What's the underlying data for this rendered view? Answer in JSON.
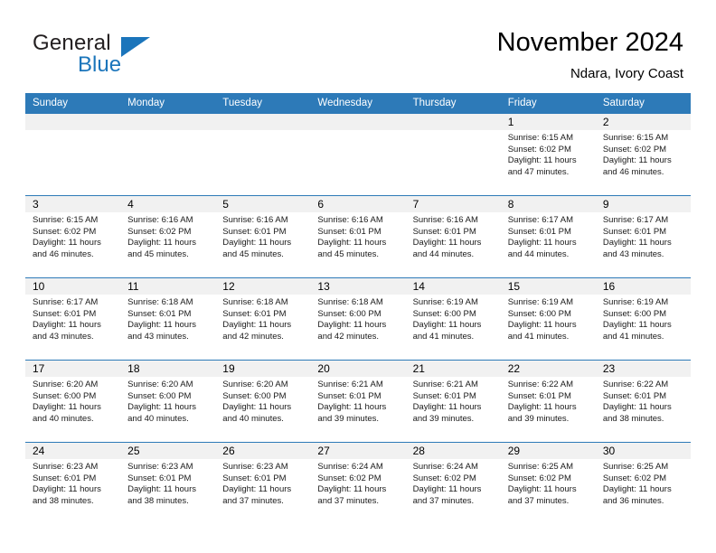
{
  "logo": {
    "primary_text": "General",
    "secondary_text": "Blue",
    "icon": "triangle-mark",
    "primary_color": "#231f20",
    "accent_color": "#1b75bb"
  },
  "header": {
    "title": "November 2024",
    "subtitle": "Ndara, Ivory Coast"
  },
  "theme": {
    "header_blue": "#2d7ab8",
    "day_band_gray": "#f1f1f1",
    "text_color": "#1a1a1a"
  },
  "calendar": {
    "weekdays": [
      "Sunday",
      "Monday",
      "Tuesday",
      "Wednesday",
      "Thursday",
      "Friday",
      "Saturday"
    ],
    "weeks": [
      [
        {
          "day": "",
          "sunrise": "",
          "sunset": "",
          "daylight_line1": "",
          "daylight_line2": ""
        },
        {
          "day": "",
          "sunrise": "",
          "sunset": "",
          "daylight_line1": "",
          "daylight_line2": ""
        },
        {
          "day": "",
          "sunrise": "",
          "sunset": "",
          "daylight_line1": "",
          "daylight_line2": ""
        },
        {
          "day": "",
          "sunrise": "",
          "sunset": "",
          "daylight_line1": "",
          "daylight_line2": ""
        },
        {
          "day": "",
          "sunrise": "",
          "sunset": "",
          "daylight_line1": "",
          "daylight_line2": ""
        },
        {
          "day": "1",
          "sunrise": "Sunrise: 6:15 AM",
          "sunset": "Sunset: 6:02 PM",
          "daylight_line1": "Daylight: 11 hours",
          "daylight_line2": "and 47 minutes."
        },
        {
          "day": "2",
          "sunrise": "Sunrise: 6:15 AM",
          "sunset": "Sunset: 6:02 PM",
          "daylight_line1": "Daylight: 11 hours",
          "daylight_line2": "and 46 minutes."
        }
      ],
      [
        {
          "day": "3",
          "sunrise": "Sunrise: 6:15 AM",
          "sunset": "Sunset: 6:02 PM",
          "daylight_line1": "Daylight: 11 hours",
          "daylight_line2": "and 46 minutes."
        },
        {
          "day": "4",
          "sunrise": "Sunrise: 6:16 AM",
          "sunset": "Sunset: 6:02 PM",
          "daylight_line1": "Daylight: 11 hours",
          "daylight_line2": "and 45 minutes."
        },
        {
          "day": "5",
          "sunrise": "Sunrise: 6:16 AM",
          "sunset": "Sunset: 6:01 PM",
          "daylight_line1": "Daylight: 11 hours",
          "daylight_line2": "and 45 minutes."
        },
        {
          "day": "6",
          "sunrise": "Sunrise: 6:16 AM",
          "sunset": "Sunset: 6:01 PM",
          "daylight_line1": "Daylight: 11 hours",
          "daylight_line2": "and 45 minutes."
        },
        {
          "day": "7",
          "sunrise": "Sunrise: 6:16 AM",
          "sunset": "Sunset: 6:01 PM",
          "daylight_line1": "Daylight: 11 hours",
          "daylight_line2": "and 44 minutes."
        },
        {
          "day": "8",
          "sunrise": "Sunrise: 6:17 AM",
          "sunset": "Sunset: 6:01 PM",
          "daylight_line1": "Daylight: 11 hours",
          "daylight_line2": "and 44 minutes."
        },
        {
          "day": "9",
          "sunrise": "Sunrise: 6:17 AM",
          "sunset": "Sunset: 6:01 PM",
          "daylight_line1": "Daylight: 11 hours",
          "daylight_line2": "and 43 minutes."
        }
      ],
      [
        {
          "day": "10",
          "sunrise": "Sunrise: 6:17 AM",
          "sunset": "Sunset: 6:01 PM",
          "daylight_line1": "Daylight: 11 hours",
          "daylight_line2": "and 43 minutes."
        },
        {
          "day": "11",
          "sunrise": "Sunrise: 6:18 AM",
          "sunset": "Sunset: 6:01 PM",
          "daylight_line1": "Daylight: 11 hours",
          "daylight_line2": "and 43 minutes."
        },
        {
          "day": "12",
          "sunrise": "Sunrise: 6:18 AM",
          "sunset": "Sunset: 6:01 PM",
          "daylight_line1": "Daylight: 11 hours",
          "daylight_line2": "and 42 minutes."
        },
        {
          "day": "13",
          "sunrise": "Sunrise: 6:18 AM",
          "sunset": "Sunset: 6:00 PM",
          "daylight_line1": "Daylight: 11 hours",
          "daylight_line2": "and 42 minutes."
        },
        {
          "day": "14",
          "sunrise": "Sunrise: 6:19 AM",
          "sunset": "Sunset: 6:00 PM",
          "daylight_line1": "Daylight: 11 hours",
          "daylight_line2": "and 41 minutes."
        },
        {
          "day": "15",
          "sunrise": "Sunrise: 6:19 AM",
          "sunset": "Sunset: 6:00 PM",
          "daylight_line1": "Daylight: 11 hours",
          "daylight_line2": "and 41 minutes."
        },
        {
          "day": "16",
          "sunrise": "Sunrise: 6:19 AM",
          "sunset": "Sunset: 6:00 PM",
          "daylight_line1": "Daylight: 11 hours",
          "daylight_line2": "and 41 minutes."
        }
      ],
      [
        {
          "day": "17",
          "sunrise": "Sunrise: 6:20 AM",
          "sunset": "Sunset: 6:00 PM",
          "daylight_line1": "Daylight: 11 hours",
          "daylight_line2": "and 40 minutes."
        },
        {
          "day": "18",
          "sunrise": "Sunrise: 6:20 AM",
          "sunset": "Sunset: 6:00 PM",
          "daylight_line1": "Daylight: 11 hours",
          "daylight_line2": "and 40 minutes."
        },
        {
          "day": "19",
          "sunrise": "Sunrise: 6:20 AM",
          "sunset": "Sunset: 6:00 PM",
          "daylight_line1": "Daylight: 11 hours",
          "daylight_line2": "and 40 minutes."
        },
        {
          "day": "20",
          "sunrise": "Sunrise: 6:21 AM",
          "sunset": "Sunset: 6:01 PM",
          "daylight_line1": "Daylight: 11 hours",
          "daylight_line2": "and 39 minutes."
        },
        {
          "day": "21",
          "sunrise": "Sunrise: 6:21 AM",
          "sunset": "Sunset: 6:01 PM",
          "daylight_line1": "Daylight: 11 hours",
          "daylight_line2": "and 39 minutes."
        },
        {
          "day": "22",
          "sunrise": "Sunrise: 6:22 AM",
          "sunset": "Sunset: 6:01 PM",
          "daylight_line1": "Daylight: 11 hours",
          "daylight_line2": "and 39 minutes."
        },
        {
          "day": "23",
          "sunrise": "Sunrise: 6:22 AM",
          "sunset": "Sunset: 6:01 PM",
          "daylight_line1": "Daylight: 11 hours",
          "daylight_line2": "and 38 minutes."
        }
      ],
      [
        {
          "day": "24",
          "sunrise": "Sunrise: 6:23 AM",
          "sunset": "Sunset: 6:01 PM",
          "daylight_line1": "Daylight: 11 hours",
          "daylight_line2": "and 38 minutes."
        },
        {
          "day": "25",
          "sunrise": "Sunrise: 6:23 AM",
          "sunset": "Sunset: 6:01 PM",
          "daylight_line1": "Daylight: 11 hours",
          "daylight_line2": "and 38 minutes."
        },
        {
          "day": "26",
          "sunrise": "Sunrise: 6:23 AM",
          "sunset": "Sunset: 6:01 PM",
          "daylight_line1": "Daylight: 11 hours",
          "daylight_line2": "and 37 minutes."
        },
        {
          "day": "27",
          "sunrise": "Sunrise: 6:24 AM",
          "sunset": "Sunset: 6:02 PM",
          "daylight_line1": "Daylight: 11 hours",
          "daylight_line2": "and 37 minutes."
        },
        {
          "day": "28",
          "sunrise": "Sunrise: 6:24 AM",
          "sunset": "Sunset: 6:02 PM",
          "daylight_line1": "Daylight: 11 hours",
          "daylight_line2": "and 37 minutes."
        },
        {
          "day": "29",
          "sunrise": "Sunrise: 6:25 AM",
          "sunset": "Sunset: 6:02 PM",
          "daylight_line1": "Daylight: 11 hours",
          "daylight_line2": "and 37 minutes."
        },
        {
          "day": "30",
          "sunrise": "Sunrise: 6:25 AM",
          "sunset": "Sunset: 6:02 PM",
          "daylight_line1": "Daylight: 11 hours",
          "daylight_line2": "and 36 minutes."
        }
      ]
    ]
  }
}
